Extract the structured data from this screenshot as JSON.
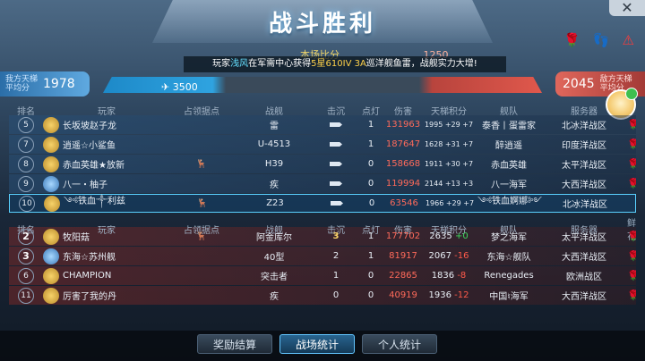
{
  "header": {
    "title": "战斗胜利",
    "score_label": "本场比分",
    "score_right": "1250",
    "close_label": "✕",
    "broadcast": {
      "pre": "玩家",
      "player": "浅风",
      "mid": "在军需中心获得",
      "item": "5星610IV 3A",
      "post": "巡洋舰鱼雷，战舰实力大增!"
    }
  },
  "ladder": {
    "our_label": "我方天梯平均分",
    "our_value": "1978",
    "enemy_label": "敌方天梯平均分",
    "enemy_value": "2045",
    "our_power": "3500"
  },
  "team_top": {
    "headers": [
      "排名",
      "玩家",
      "占领据点",
      "战舰",
      "击沉",
      "点灯",
      "伤害",
      "天梯积分",
      "舰队",
      "服务器",
      ""
    ],
    "rows": [
      {
        "rank": "5",
        "player": "长坂坡赵子龙",
        "capture": "",
        "ship": "雷",
        "sink": "1",
        "light": "0",
        "damage": "131963",
        "ladder": "1995 +29 +7",
        "fleet": "泰香丨蛋雷家",
        "server": "北冰洋战区"
      },
      {
        "rank": "7",
        "player": "逍遥☆小鲨鱼",
        "capture": "",
        "ship": "U-4513",
        "sink": "1",
        "light": "0",
        "damage": "187647",
        "ladder": "1628 +31 +7",
        "fleet": "醉逍遥",
        "server": "印度洋战区"
      },
      {
        "rank": "8",
        "player": "赤血英雄★放新",
        "capture": "🦌",
        "ship": "H39",
        "sink": "0",
        "light": "0",
        "damage": "158668",
        "ladder": "1911 +30 +7",
        "fleet": "赤血英雄",
        "server": "太平洋战区"
      },
      {
        "rank": "9",
        "player": "八一・柚子",
        "capture": "",
        "ship": "疾",
        "sink": "0",
        "light": "2",
        "damage": "119994",
        "ladder": "2144 +13 +3",
        "fleet": "八一海军",
        "server": "大西洋战区"
      },
      {
        "rank": "10",
        "player": "༺铁血༒利兹",
        "capture": "🦌",
        "ship": "Z23",
        "sink": "0",
        "light": "1",
        "damage": "63546",
        "ladder": "1966 +29 +7",
        "fleet": "༺铁血婀娜༻",
        "server": "北冰洋战区"
      }
    ]
  },
  "team_bottom": {
    "headers": [
      "排名",
      "玩家",
      "占领据点",
      "战舰",
      "击沉",
      "点灯",
      "伤害",
      "天梯积分",
      "舰队",
      "服务器",
      "鲜花"
    ],
    "rows": [
      {
        "rank": "2",
        "player": "牧阳菇",
        "capture": "🦌",
        "ship": "阿金库尔",
        "sink": "3",
        "light": "1",
        "damage": "177702",
        "ladder": "2635",
        "delta": "+0",
        "fleet": "梦之海军",
        "server": "太平洋战区"
      },
      {
        "rank": "3",
        "player": "东海☆苏州舰",
        "capture": "",
        "ship": "40型",
        "sink": "2",
        "light": "1",
        "damage": "81917",
        "ladder": "2067",
        "delta": "-16",
        "fleet": "东海☆舰队",
        "server": "大西洋战区"
      },
      {
        "rank": "6",
        "player": "CHAMPION",
        "capture": "",
        "ship": "突击者",
        "sink": "1",
        "light": "0",
        "damage": "22865",
        "ladder": "1836",
        "delta": "-8",
        "fleet": "Renegades",
        "server": "欧洲战区"
      },
      {
        "rank": "11",
        "player": "厉害了我的丹",
        "capture": "",
        "ship": "疾",
        "sink": "0",
        "light": "0",
        "damage": "40919",
        "ladder": "1936",
        "delta": "-12",
        "fleet": "中国♮海军",
        "server": "大西洋战区"
      }
    ]
  },
  "tabs": [
    "奖励结算",
    "战场统计",
    "个人统计"
  ],
  "icons": {
    "rose": "🌹",
    "ship": "ship-icon",
    "deer": "deer-icon"
  }
}
